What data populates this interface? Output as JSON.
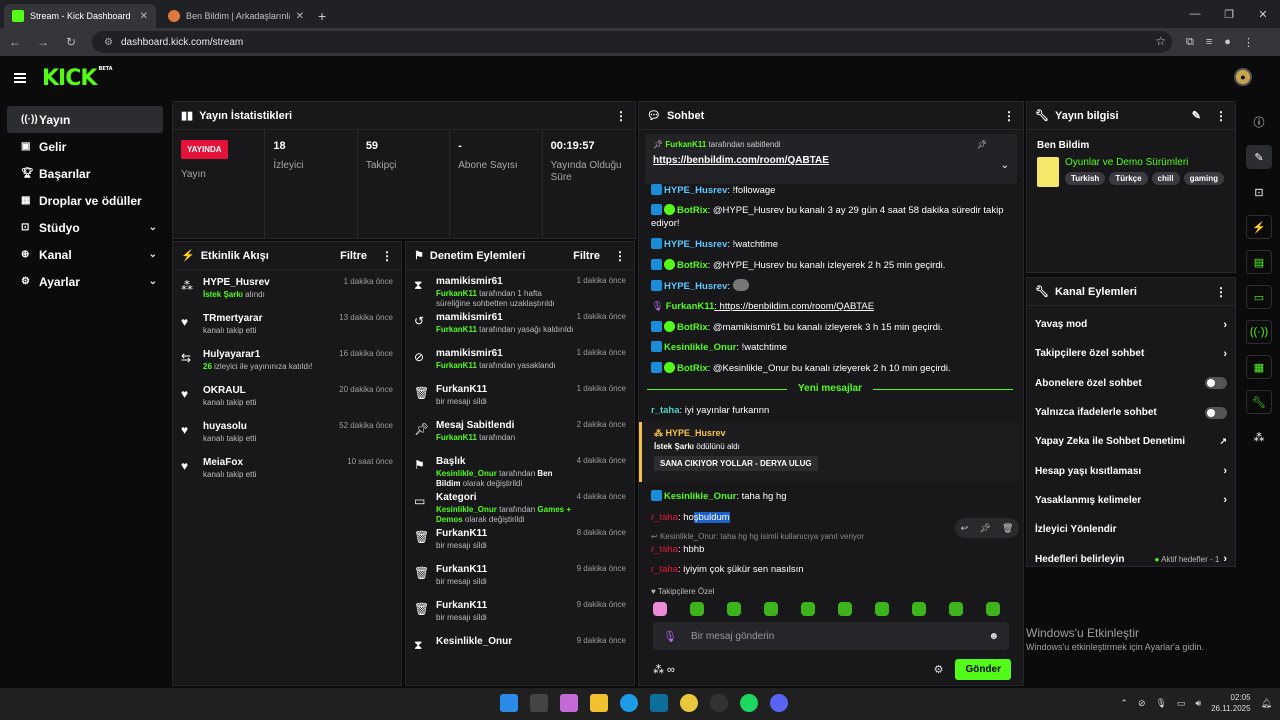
{
  "browser": {
    "tabs": [
      {
        "label": "Stream - Kick Dashboard",
        "active": true
      },
      {
        "label": "Ben Bildim | Arkadaşlarınla Onli",
        "active": false
      }
    ],
    "url": "dashboard.kick.com/stream"
  },
  "sidebar": {
    "items": [
      {
        "label": "Yayın",
        "icon": "broadcast-icon",
        "active": true
      },
      {
        "label": "Gelir",
        "icon": "dollar-icon"
      },
      {
        "label": "Başarılar",
        "icon": "trophy-icon"
      },
      {
        "label": "Droplar ve ödüller",
        "icon": "gift-icon"
      },
      {
        "label": "Stüdyo",
        "icon": "studio-icon",
        "chevron": true
      },
      {
        "label": "Kanal",
        "icon": "channel-icon",
        "chevron": true
      },
      {
        "label": "Ayarlar",
        "icon": "gear-icon",
        "chevron": true
      }
    ]
  },
  "stats": {
    "title": "Yayın İstatistikleri",
    "live_badge": "YAYINDA",
    "items": [
      {
        "value": "",
        "label": "Yayın"
      },
      {
        "value": "18",
        "label": "İzleyici"
      },
      {
        "value": "59",
        "label": "Takipçi"
      },
      {
        "value": "-",
        "label": "Abone Sayısı"
      },
      {
        "value": "00:19:57",
        "label": "Yayında Olduğu Süre"
      }
    ]
  },
  "activity": {
    "title": "Etkinlik Akışı",
    "filter": "Filtre",
    "rows": [
      {
        "name": "HYPE_Husrev",
        "sub_hl": "İstek Şarkı",
        "sub": " alındı",
        "time": "1 dakika önce"
      },
      {
        "name": "TRmertyarar",
        "sub_hl": "",
        "sub": "kanalı takip etti",
        "time": "13 dakika önce"
      },
      {
        "name": "Hulyayarar1",
        "sub_hl": "26",
        "sub": " izleyici ile yayınınıza katıldı!",
        "time": "16 dakika önce"
      },
      {
        "name": "OKRAUL",
        "sub_hl": "",
        "sub": "kanalı takip etti",
        "time": "20 dakika önce"
      },
      {
        "name": "huyasolu",
        "sub_hl": "",
        "sub": "kanalı takip etti",
        "time": "52 dakika önce"
      },
      {
        "name": "MeiaFox",
        "sub_hl": "",
        "sub": "kanalı takip etti",
        "time": "10 saat önce"
      }
    ]
  },
  "moderation": {
    "title": "Denetim Eylemleri",
    "filter": "Filtre",
    "rows": [
      {
        "name": "mamikismir61",
        "actor": "FurkanK11",
        "sub": " tarafından 1 hafta süreliğine sohbetten uzaklaştırıldı",
        "time": "1 dakika önce"
      },
      {
        "name": "mamikismir61",
        "actor": "FurkanK11",
        "sub": " tarafından yasağı kaldırıldı",
        "time": "1 dakika önce"
      },
      {
        "name": "mamikismir61",
        "actor": "FurkanK11",
        "sub": " tarafından yasaklandı",
        "time": "1 dakika önce"
      },
      {
        "name": "FurkanK11",
        "actor": "",
        "sub": "bir mesajı sildi",
        "time": "1 dakika önce"
      },
      {
        "name": "Mesaj Sabitlendi",
        "actor": "FurkanK11",
        "sub": " tarafından",
        "time": "2 dakika önce"
      },
      {
        "name": "Başlık",
        "actor": "Kesinlikle_Onur",
        "sub": " tarafından ",
        "sub_w": "Ben Bildim",
        "sub2": " olarak değiştirildi",
        "time": "4 dakika önce"
      },
      {
        "name": "Kategori",
        "actor": "Kesinlikle_Onur",
        "sub": " tarafından ",
        "sub_g": "Games + Demos",
        "sub2": " olarak değiştirildi",
        "time": "4 dakika önce"
      },
      {
        "name": "FurkanK11",
        "actor": "",
        "sub": "bir mesajı sildi",
        "time": "8 dakika önce"
      },
      {
        "name": "FurkanK11",
        "actor": "",
        "sub": "bir mesajı sildi",
        "time": "9 dakika önce"
      },
      {
        "name": "FurkanK11",
        "actor": "",
        "sub": "bir mesajı sildi",
        "time": "9 dakika önce"
      },
      {
        "name": "Kesinlikle_Onur",
        "actor": "",
        "sub": "",
        "time": "9 dakika önce"
      }
    ]
  },
  "chat": {
    "title": "Sohbet",
    "pinned_by_user": "FurkanK11",
    "pinned_by_text": " tarafından sabitlendi",
    "pinned_url": "https://benbildim.com/room/QABTAE",
    "messages": [
      {
        "user": "HYPE_Husrev",
        "color": "#5ec8ff",
        "text": ": !followage"
      },
      {
        "user": "BotRix",
        "color": "#53fc18",
        "text": ": @HYPE_Husrev bu kanalı 3 ay 29 gün 4 saat 58 dakika süredir takip ediyor!"
      },
      {
        "user": "HYPE_Husrev",
        "color": "#5ec8ff",
        "text": ": !watchtime"
      },
      {
        "user": "BotRix",
        "color": "#53fc18",
        "text": ": @HYPE_Husrev bu kanalı izleyerek 2 h 25 min geçirdi."
      },
      {
        "user": "HYPE_Husrev",
        "color": "#5ec8ff",
        "text": ":"
      },
      {
        "user": "FurkanK11",
        "color": "#53fc18",
        "text": ": https://benbildim.com/room/QABTAE"
      },
      {
        "user": "BotRix",
        "color": "#53fc18",
        "text": ": @mamikismir61 bu kanalı izleyerek 3 h 15 min geçirdi."
      },
      {
        "user": "Kesinlikle_Onur",
        "color": "#53fc18",
        "text": ": !watchtime"
      },
      {
        "user": "BotRix",
        "color": "#53fc18",
        "text": ": @Kesinlikle_Onur bu kanalı izleyerek 2 h 10 min geçirdi."
      }
    ],
    "new_messages": "Yeni mesajlar",
    "after": [
      {
        "user": "r_taha",
        "color": "#4fd1c5",
        "text": ": iyi yayınlar furkannn"
      }
    ],
    "redeem": {
      "user": "HYPE_Husrev",
      "reward": "İstek Şarkı",
      "suffix": " ödülünü aldı",
      "song": "SANA CIKIYOR YOLLAR - DERYA ULUG"
    },
    "late": [
      {
        "user": "Kesinlikle_Onur",
        "color": "#53fc18",
        "text": ": taha hg hg"
      },
      {
        "user": "r_taha",
        "color": "#e5133a",
        "text": ": ho",
        "hl": "şbuldum"
      },
      {
        "user": "r_taha",
        "color": "#e5133a",
        "text": ": hbhb"
      },
      {
        "user": "r_taha",
        "color": "#e5133a",
        "text": ": iyiyim çok şükür sen nasılsın"
      }
    ],
    "reply_preview": "Kesinlikle_Onur: taha hg hg isimli kullanıcıya yanıt veriyor",
    "followers_only": "Takipçilere Özel",
    "input_placeholder": "Bir mesaj gönderin",
    "send": "Gönder"
  },
  "stream_info": {
    "title": "Yayın bilgisi",
    "stream_title": "Ben Bildim",
    "category": "Oyunlar ve Demo Sürümleri",
    "tags": [
      "Turkish",
      "Türkçe",
      "chill",
      "gaming"
    ]
  },
  "channel_actions": {
    "title": "Kanal Eylemleri",
    "items": [
      {
        "label": "Yavaş mod",
        "type": "chevron"
      },
      {
        "label": "Takipçilere özel sohbet",
        "type": "chevron"
      },
      {
        "label": "Abonelere özel sohbet",
        "type": "toggle"
      },
      {
        "label": "Yalnızca ifadelerle sohbet",
        "type": "toggle"
      },
      {
        "label": "Yapay Zeka ile Sohbet Denetimi",
        "type": "external"
      },
      {
        "label": "Hesap yaşı kısıtlaması",
        "type": "chevron"
      },
      {
        "label": "Yasaklanmış kelimeler",
        "type": "chevron"
      },
      {
        "label": "İzleyici Yönlendir",
        "type": "none"
      },
      {
        "label": "Hedefleri belirleyin",
        "type": "goals",
        "extra": "Aktif hedefler - 1"
      }
    ]
  },
  "windows": {
    "watermark_title": "Windows'u Etkinleştir",
    "watermark_sub": "Windows'u etkinleştirmek için Ayarlar'a gidin.",
    "time": "02:05",
    "date": "26.11.2025"
  },
  "colors": {
    "accent": "#53fc18",
    "live": "#e5133a",
    "panel": "#18181b"
  }
}
